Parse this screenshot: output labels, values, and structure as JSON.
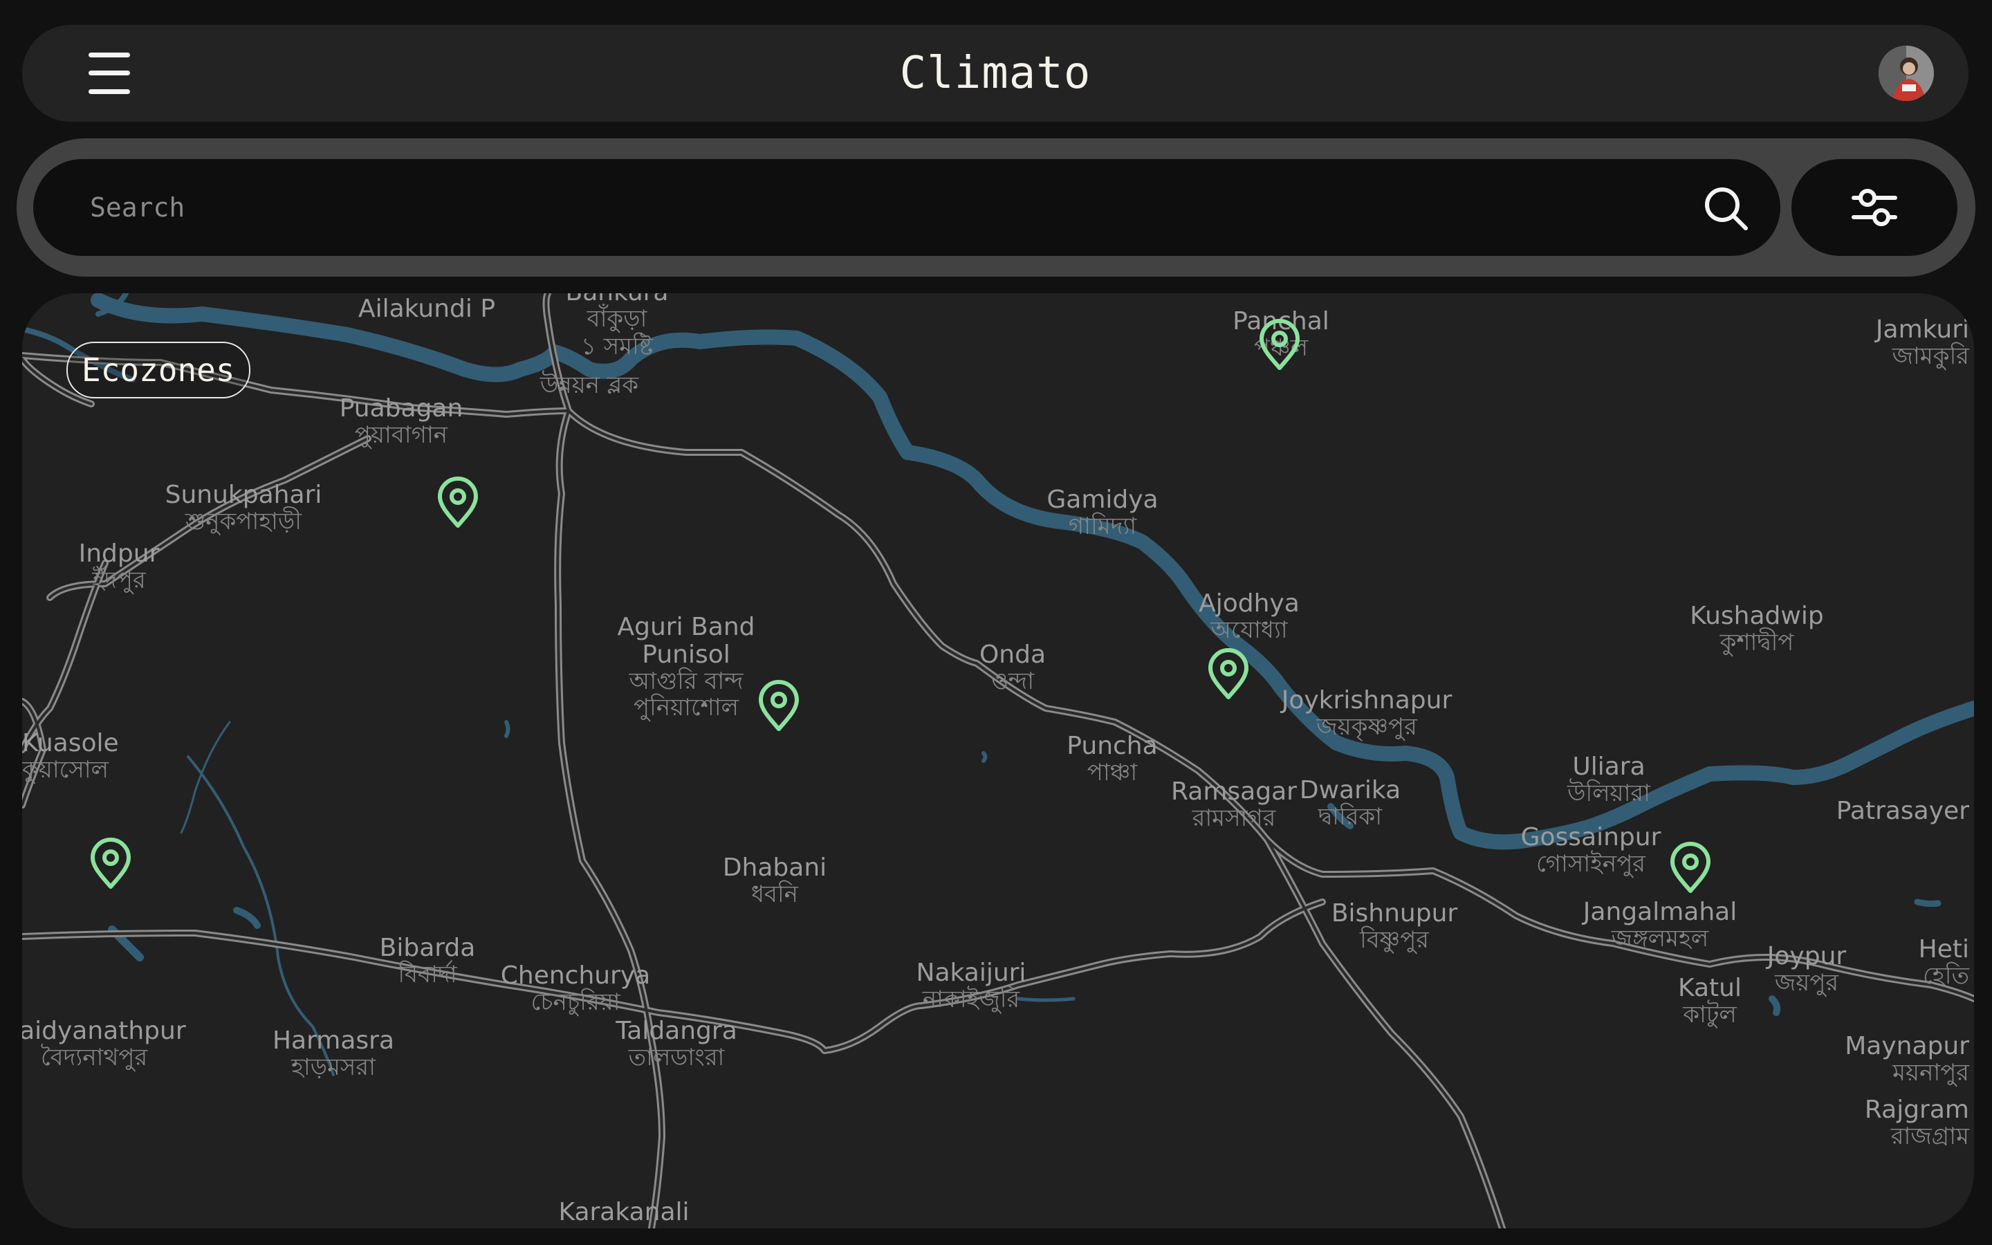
{
  "app": {
    "title": "Climato"
  },
  "search": {
    "placeholder": "Search",
    "value": ""
  },
  "map": {
    "chip_label": "Ecozones",
    "places": [
      {
        "name": "Ailakundi P",
        "local": ""
      },
      {
        "name": "Bankura",
        "local": "বাঁকুড়া"
      },
      {
        "name": "",
        "local": "১ সমষ্টি"
      },
      {
        "name": "",
        "local": "উন্নয়ন ব্লক"
      },
      {
        "name": "Puabagan",
        "local": "পুয়াবাগান"
      },
      {
        "name": "Sunukpahari",
        "local": "শুনুকপাহাড়ী"
      },
      {
        "name": "Indpur",
        "local": "ইঁদপুর"
      },
      {
        "name": "Aguri Band",
        "local": ""
      },
      {
        "name": "Punisol",
        "local": "আগুরি বান্দ"
      },
      {
        "name": "",
        "local": "পুনিয়াশোল"
      },
      {
        "name": "Gamidya",
        "local": "গামিদ্যা"
      },
      {
        "name": "Ajodhya",
        "local": "অযোধ্যা"
      },
      {
        "name": "Onda",
        "local": "ওন্দা"
      },
      {
        "name": "Puncha",
        "local": "পাঞ্চা"
      },
      {
        "name": "Ramsagar",
        "local": "রামসাগর"
      },
      {
        "name": "Dwarika",
        "local": "দ্বারিকা"
      },
      {
        "name": "Joykrishnapur",
        "local": "জয়কৃষ্ণপুর"
      },
      {
        "name": "Kushadwip",
        "local": "কুশাদ্বীপ"
      },
      {
        "name": "Uliara",
        "local": "উলিয়ারা"
      },
      {
        "name": "Gossainpur",
        "local": "গোসাইনপুর"
      },
      {
        "name": "Bishnupur",
        "local": "বিষ্ণুপুর"
      },
      {
        "name": "Jangalmahal",
        "local": "জঙ্গলমহল"
      },
      {
        "name": "Joypur",
        "local": "জয়পুর"
      },
      {
        "name": "Katul",
        "local": "কাটুল"
      },
      {
        "name": "Dhabani",
        "local": "ধবনি"
      },
      {
        "name": "Bibarda",
        "local": "বিবার্দা"
      },
      {
        "name": "Chenchurya",
        "local": "চেনচুরিয়া"
      },
      {
        "name": "Nakaijuri",
        "local": "নাকাইজুরি"
      },
      {
        "name": "Taldangra",
        "local": "তালডাংরা"
      },
      {
        "name": "Harmasra",
        "local": "হাড়মসরা"
      },
      {
        "name": "Baidyanathpur",
        "local": "বৈদ্যনাথপুর"
      },
      {
        "name": "Karakanali",
        "local": ""
      },
      {
        "name": "Panchal",
        "local": "পঞ্চল"
      },
      {
        "name": "Jamkuri",
        "local": "জামকুরি"
      },
      {
        "name": "Patrasayer",
        "local": ""
      },
      {
        "name": "Heti",
        "local": "হেতি"
      },
      {
        "name": "Rajgram",
        "local": "রাজগ্রাম"
      },
      {
        "name": "Maynapur",
        "local": "ময়নাপুর"
      },
      {
        "name": "Kuasole",
        "local": "কুয়াসোল"
      }
    ],
    "marker_color": "#8be29c",
    "water_color": "#335d74",
    "road_color": "#8a8a8a"
  },
  "icons": {
    "menu": "hamburger-menu-icon",
    "search": "search-icon",
    "filter": "sliders-icon",
    "marker": "map-pin-icon"
  }
}
